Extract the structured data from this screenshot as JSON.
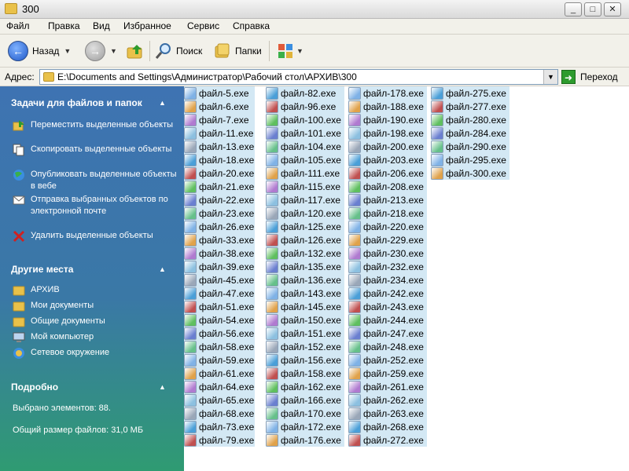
{
  "window": {
    "title": "300"
  },
  "menu": {
    "items": [
      "Файл",
      "Правка",
      "Вид",
      "Избранное",
      "Сервис",
      "Справка"
    ]
  },
  "toolbar": {
    "back_label": "Назад",
    "search_label": "Поиск",
    "folders_label": "Папки"
  },
  "address": {
    "label": "Адрес:",
    "path": "E:\\Documents and Settings\\Администратор\\Рабочий стол\\АРХИВ\\300",
    "go_label": "Переход"
  },
  "left_pane": {
    "tasks_title": "Задачи для файлов и папок",
    "tasks": [
      "Переместить выделенные объекты",
      "Скопировать выделенные объекты",
      "Опубликовать выделенные объекты в вебе",
      "Отправка выбранных объектов по электронной почте",
      "Удалить выделенные объекты"
    ],
    "places_title": "Другие места",
    "places": [
      "АРХИВ",
      "Мои документы",
      "Общие документы",
      "Мой компьютер",
      "Сетевое окружение"
    ],
    "details_title": "Подробно",
    "details_selected": "Выбрано элементов: 88.",
    "details_size": "Общий размер файлов: 31,0 МБ"
  },
  "files": {
    "col1": [
      "файл-5.exe",
      "файл-6.exe",
      "файл-7.exe",
      "файл-11.exe",
      "файл-13.exe",
      "файл-18.exe",
      "файл-20.exe",
      "файл-21.exe",
      "файл-22.exe",
      "файл-23.exe",
      "файл-26.exe",
      "файл-33.exe",
      "файл-38.exe",
      "файл-39.exe",
      "файл-45.exe",
      "файл-47.exe",
      "файл-51.exe",
      "файл-54.exe",
      "файл-56.exe",
      "файл-58.exe",
      "файл-59.exe",
      "файл-61.exe",
      "файл-64.exe",
      "файл-65.exe",
      "файл-68.exe",
      "файл-73.exe",
      "файл-79.exe"
    ],
    "col2": [
      "файл-82.exe",
      "файл-96.exe",
      "файл-100.exe",
      "файл-101.exe",
      "файл-104.exe",
      "файл-105.exe",
      "файл-111.exe",
      "файл-115.exe",
      "файл-117.exe",
      "файл-120.exe",
      "файл-125.exe",
      "файл-126.exe",
      "файл-132.exe",
      "файл-135.exe",
      "файл-136.exe",
      "файл-143.exe",
      "файл-145.exe",
      "файл-150.exe",
      "файл-151.exe",
      "файл-152.exe",
      "файл-156.exe",
      "файл-158.exe",
      "файл-162.exe",
      "файл-166.exe",
      "файл-170.exe",
      "файл-172.exe",
      "файл-176.exe"
    ],
    "col3": [
      "файл-178.exe",
      "файл-188.exe",
      "файл-190.exe",
      "файл-198.exe",
      "файл-200.exe",
      "файл-203.exe",
      "файл-206.exe",
      "файл-208.exe",
      "файл-213.exe",
      "файл-218.exe",
      "файл-220.exe",
      "файл-229.exe",
      "файл-230.exe",
      "файл-232.exe",
      "файл-234.exe",
      "файл-242.exe",
      "файл-243.exe",
      "файл-244.exe",
      "файл-247.exe",
      "файл-248.exe",
      "файл-252.exe",
      "файл-259.exe",
      "файл-261.exe",
      "файл-262.exe",
      "файл-263.exe",
      "файл-268.exe",
      "файл-272.exe"
    ],
    "col4": [
      "файл-275.exe",
      "файл-277.exe",
      "файл-280.exe",
      "файл-284.exe",
      "файл-290.exe",
      "файл-295.exe",
      "файл-300.exe"
    ]
  },
  "colors": {
    "selection": "#d3e8f4",
    "pane_top": "#3e73b2",
    "pane_bottom": "#2f9b72",
    "folder": "#e9c14a",
    "icon_palette": [
      "#7fb2e6",
      "#5fbf5f",
      "#9aa7b8",
      "#e0a24a",
      "#6a7fd0",
      "#4a9fd8",
      "#b07ad0",
      "#66c08a",
      "#c05050",
      "#8cc0e0"
    ]
  }
}
